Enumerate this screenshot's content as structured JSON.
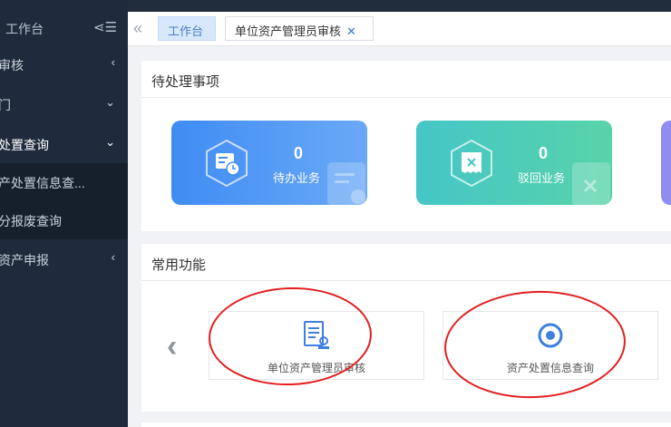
{
  "sidebar": {
    "title": "工作台",
    "items": [
      {
        "label": "审核",
        "arrow": "‹"
      },
      {
        "label": "门",
        "arrow": "⌄"
      },
      {
        "label": "处置查询",
        "arrow": "⌄"
      },
      {
        "label": "产处置信息查...",
        "arrow": ""
      },
      {
        "label": "分报废查询",
        "arrow": ""
      },
      {
        "label": "资产申报",
        "arrow": "‹"
      }
    ]
  },
  "tabs": {
    "home": "工作台",
    "current": "单位资产管理员审核",
    "close": "✕"
  },
  "pending": {
    "title": "待处理事项",
    "cards": [
      {
        "count": "0",
        "label": "待办业务"
      },
      {
        "count": "0",
        "label": "驳回业务"
      }
    ]
  },
  "common": {
    "title": "常用功能",
    "items": [
      {
        "label": "单位资产管理员审核"
      },
      {
        "label": "资产处置信息查询"
      }
    ]
  },
  "colors": {
    "sidebar_bg": "#1e2b3c",
    "card_blue": "#3f8cf3",
    "card_green": "#45c6c7",
    "accent": "#3b73c6",
    "annotation": "#e21e1e"
  }
}
